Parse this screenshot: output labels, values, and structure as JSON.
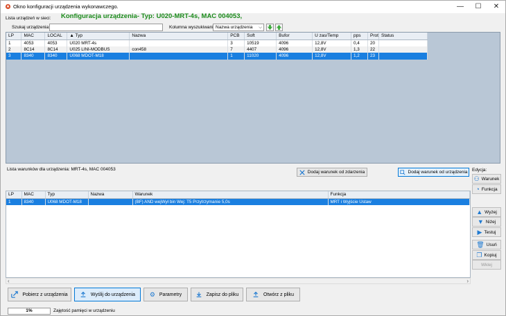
{
  "window": {
    "title": "Okno konfiguracji urządzenia wykonawczego.",
    "minimize": "—",
    "maximize": "☐",
    "close": "✕"
  },
  "top": {
    "list_label": "Lista urządzeń w sieci:",
    "config_title": "Konfiguracja urządzenia- Typ: U020-MRT-4s, MAC 004053,",
    "search_label": "Szukaj urządzenia:",
    "search_value": "",
    "search_column_label": "Kolumna wyszukiwania:",
    "search_column_value": "Nazwa urządzenia"
  },
  "devices": {
    "columns": [
      "LP",
      "MAC",
      "LOCAL",
      "▲ Typ",
      "Nazwa",
      "PCB",
      "Soft",
      "Bufor",
      "U zas/Temp",
      "pps",
      "Prot",
      "Status"
    ],
    "rows": [
      [
        "1",
        "4053",
        "4053",
        "U020 MRT-4s",
        "",
        "3",
        "10519",
        "4096",
        "12,8V",
        "0,4",
        "20",
        ""
      ],
      [
        "2",
        "8C14",
        "8C14",
        "U025 LINI-MODBUS",
        "con458",
        "7",
        "4407",
        "4096",
        "12,8V",
        "1,3",
        "22",
        ""
      ],
      [
        "3",
        "8340",
        "8340",
        "U068 MDOT-M18",
        "",
        "1",
        "11020",
        "4096",
        "12,8V",
        "1,2",
        "23",
        ""
      ]
    ],
    "selected_row": 2
  },
  "conditions": {
    "label": "Lista warunków dla urządzenia: MRT-4s, MAC 004053",
    "add_from_event": "Dodaj warunek od zdarzenia",
    "add_from_device": "Dodaj warunek od urządzenia",
    "columns": [
      "LP",
      "MAC",
      "Typ",
      "Nazwa",
      "Warunek",
      "Funkcja"
    ],
    "rows": [
      [
        "1",
        "8340",
        "U068 MDOT-M18",
        "",
        "(BF) AND  wejWył bin Wej: T5  Przytrzymanie 5,0s",
        "MRT i Wyjście Ustaw"
      ]
    ]
  },
  "side": {
    "edit_label": "Edycja:",
    "condition": "Warunek",
    "function": "Funkcja",
    "up": "Wyżej",
    "down": "Niżej",
    "test": "Testuj",
    "delete": "Usuń",
    "copy": "Kopiuj",
    "paste": "Wklej"
  },
  "bottom": {
    "fetch": "Pobierz z urządzenia",
    "send": "Wyślij do urządzenia",
    "params": "Parametry",
    "save": "Zapisz do pliku",
    "open": "Otwórz z pliku"
  },
  "status": {
    "percent": "1%",
    "memory_label": "Zajętość pamięci w urządzeniu"
  },
  "colors": {
    "accent": "#1a7fe0",
    "green_title": "#1a8a1a",
    "grid_bg": "#b9c7d6"
  }
}
